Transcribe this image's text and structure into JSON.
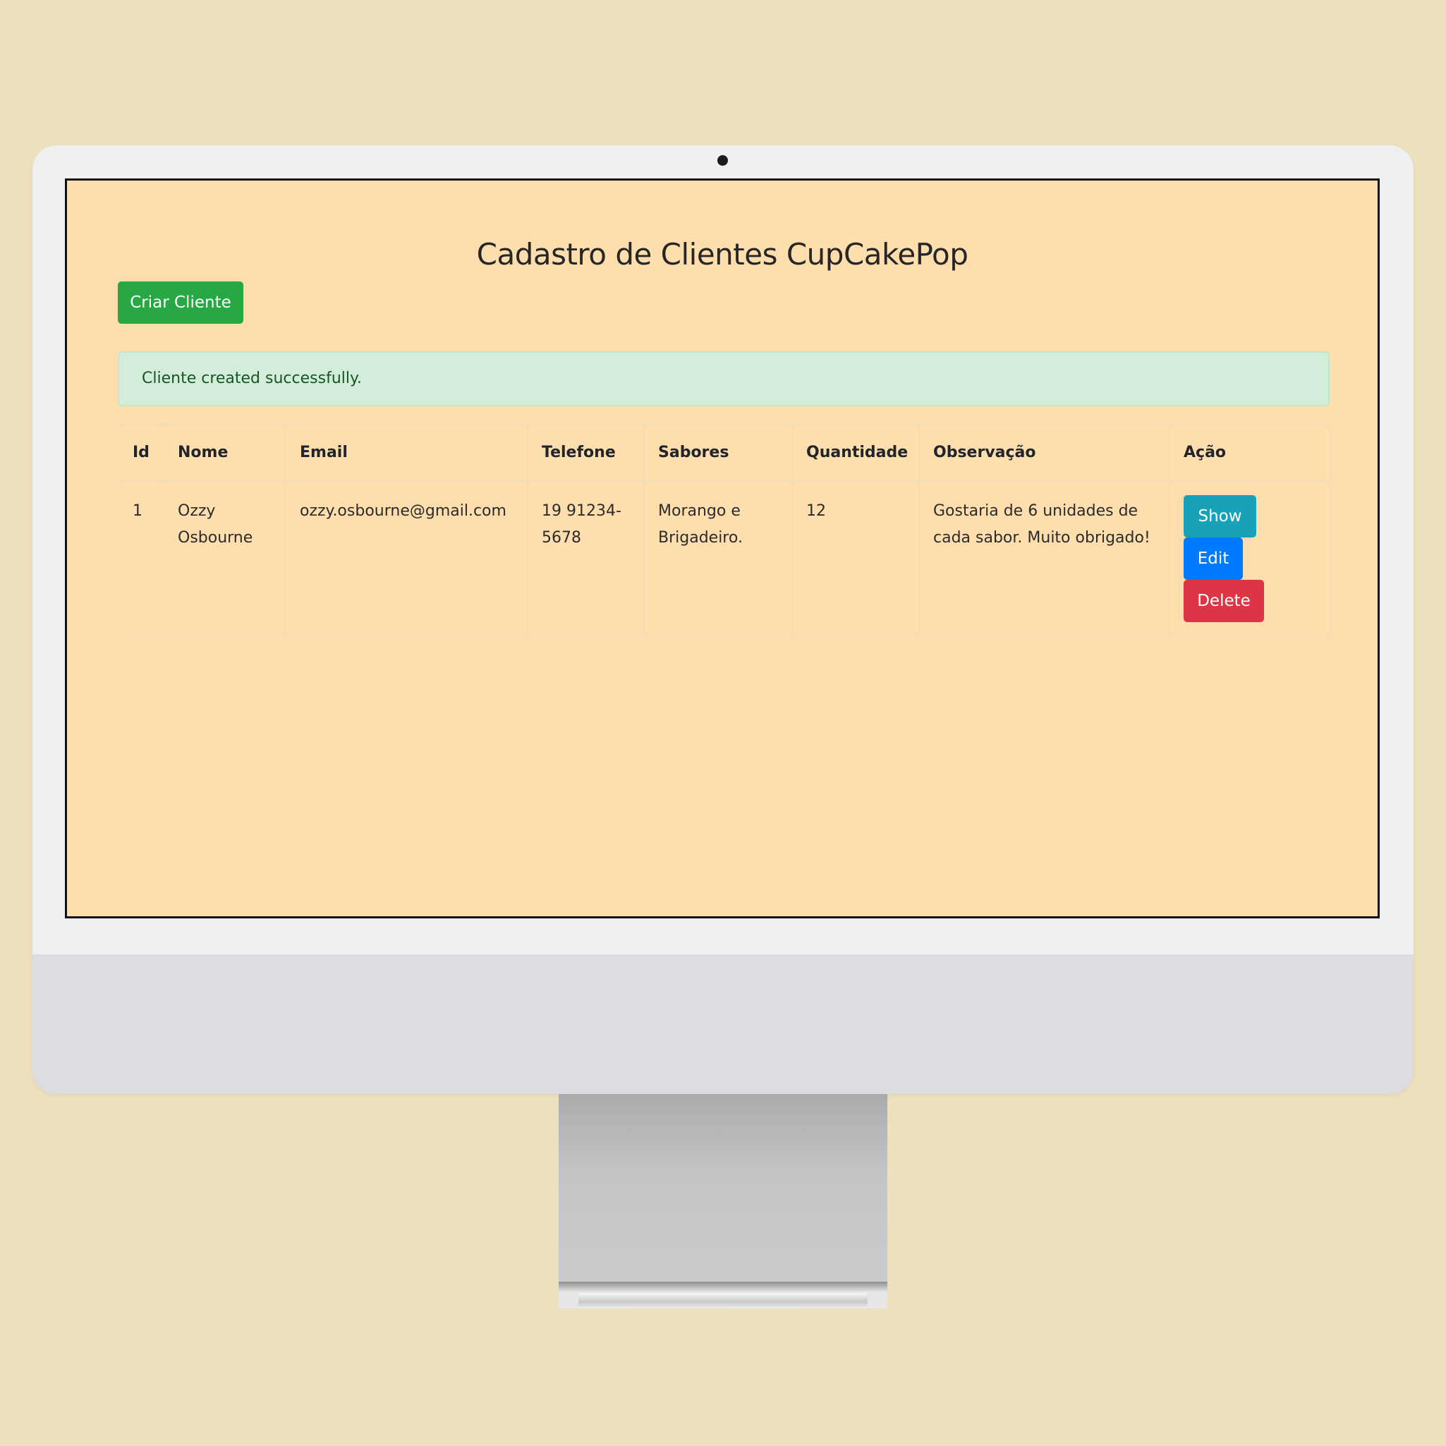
{
  "page": {
    "title": "Cadastro de Clientes CupCakePop"
  },
  "toolbar": {
    "create_label": "Criar Cliente"
  },
  "alert": {
    "message": "Cliente created successfully."
  },
  "table": {
    "headers": [
      "Id",
      "Nome",
      "Email",
      "Telefone",
      "Sabores",
      "Quantidade",
      "Observação",
      "Ação"
    ],
    "rows": [
      {
        "id": "1",
        "nome": "Ozzy Osbourne",
        "email": "ozzy.osbourne@gmail.com",
        "telefone": "19 91234-5678",
        "sabores": "Morango e Brigadeiro.",
        "quantidade": "12",
        "observacao": "Gostaria de 6 unidades de cada sabor. Muito obrigado!",
        "actions": {
          "show": "Show",
          "edit": "Edit",
          "delete": "Delete"
        }
      }
    ]
  },
  "colors": {
    "page_background": "#ffdead",
    "create_button": "#28a745",
    "alert_background": "#d4edda",
    "show_button": "#17a2b8",
    "edit_button": "#007bff",
    "delete_button": "#dc3545"
  },
  "icons": {
    "camera": "camera-dot-icon"
  }
}
